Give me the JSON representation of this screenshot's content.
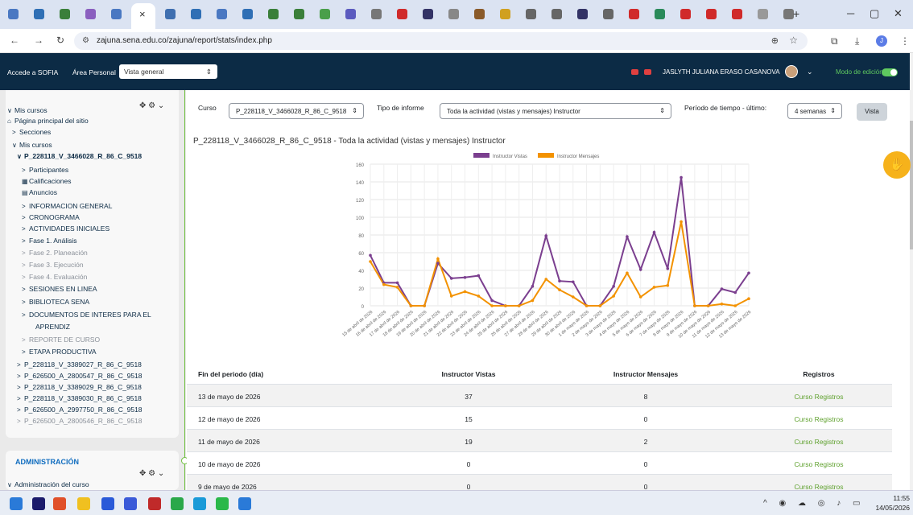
{
  "browser": {
    "url": "zajuna.sena.edu.co/zajuna/report/stats/index.php",
    "tab_close": "×",
    "new_tab": "+"
  },
  "topnav": {
    "link1": "Accede a SOFIA",
    "link2": "Área Personal",
    "view_select": "Vista general",
    "user_name": "JASLYTH JULIANA ERASO CASANOVA",
    "edit_mode": "Modo de edición"
  },
  "sidebar": {
    "items": [
      {
        "label": "Mis cursos",
        "caret": "∨"
      },
      {
        "label": "Página principal del sitio",
        "caret": "⌂"
      },
      {
        "label": "Secciones",
        "caret": ">"
      },
      {
        "label": "Mis cursos",
        "caret": "∨"
      },
      {
        "label": "P_228118_V_3466028_R_86_C_9518",
        "caret": "∨"
      },
      {
        "label": "Participantes",
        "caret": ">"
      },
      {
        "label": "Calificaciones",
        "caret": "▦"
      },
      {
        "label": "Anuncios",
        "caret": "▤"
      },
      {
        "label": "INFORMACION GENERAL",
        "caret": ">"
      },
      {
        "label": "CRONOGRAMA",
        "caret": ">"
      },
      {
        "label": "ACTIVIDADES INICIALES",
        "caret": ">"
      },
      {
        "label": "Fase 1. Análisis",
        "caret": ">"
      },
      {
        "label": "Fase 2. Planeación",
        "caret": ">"
      },
      {
        "label": "Fase 3. Ejecución",
        "caret": ">"
      },
      {
        "label": "Fase 4. Evaluación",
        "caret": ">"
      },
      {
        "label": "SESIONES EN LINEA",
        "caret": ">"
      },
      {
        "label": "BIBLIOTECA SENA",
        "caret": ">"
      },
      {
        "label": "DOCUMENTOS DE INTERES PARA EL",
        "caret": ">"
      },
      {
        "label": "APRENDIZ",
        "caret": ""
      },
      {
        "label": "REPORTE DE CURSO",
        "caret": ">"
      },
      {
        "label": "ETAPA PRODUCTIVA",
        "caret": ">"
      },
      {
        "label": "P_228118_V_3389027_R_86_C_9518",
        "caret": ">"
      },
      {
        "label": "P_626500_A_2800547_R_86_C_9518",
        "caret": ">"
      },
      {
        "label": "P_228118_V_3389029_R_86_C_9518",
        "caret": ">"
      },
      {
        "label": "P_228118_V_3389030_R_86_C_9518",
        "caret": ">"
      },
      {
        "label": "P_626500_A_2997750_R_86_C_9518",
        "caret": ">"
      },
      {
        "label": "P_626500_A_2800546_R_86_C_9518",
        "caret": ">"
      }
    ],
    "admin_title": "ADMINISTRACIÓN",
    "admin_item": "Administración del curso",
    "admin_caret": "∨"
  },
  "filters": {
    "course_label": "Curso",
    "course_value": "P_228118_V_3466028_R_86_C_9518",
    "report_label": "Tipo de informe",
    "report_value": "Toda la actividad (vistas y mensajes) Instructor",
    "period_label": "Período de tiempo - último:",
    "period_value": "4 semanas",
    "view_button": "Vista"
  },
  "chart_title": "P_228118_V_3466028_R_86_C_9518 - Toda la actividad (vistas y mensajes) Instructor",
  "colors": {
    "vistas": "#7b3f8f",
    "mensajes": "#f39200",
    "accent": "#0c2b45"
  },
  "chart_data": {
    "type": "line",
    "x": [
      "15 de abril de 2026",
      "16 de abril de 2026",
      "17 de abril de 2026",
      "18 de abril de 2026",
      "19 de abril de 2026",
      "20 de abril de 2026",
      "21 de abril de 2026",
      "22 de abril de 2026",
      "23 de abril de 2026",
      "24 de abril de 2026",
      "25 de abril de 2026",
      "26 de abril de 2026",
      "27 de abril de 2026",
      "28 de abril de 2026",
      "29 de abril de 2026",
      "30 de abril de 2026",
      "1 de mayo de 2026",
      "2 de mayo de 2026",
      "3 de mayo de 2026",
      "4 de mayo de 2026",
      "5 de mayo de 2026",
      "6 de mayo de 2026",
      "7 de mayo de 2026",
      "8 de mayo de 2026",
      "9 de mayo de 2026",
      "10 de mayo de 2026",
      "11 de mayo de 2026",
      "12 de mayo de 2026",
      "13 de mayo de 2026"
    ],
    "series": [
      {
        "name": "Instructor Vistas",
        "values": [
          57,
          26,
          26,
          0,
          0,
          48,
          31,
          32,
          34,
          6,
          0,
          0,
          22,
          79,
          28,
          27,
          0,
          0,
          22,
          78,
          41,
          83,
          42,
          145,
          0,
          0,
          19,
          15,
          37
        ]
      },
      {
        "name": "Instructor Mensajes",
        "values": [
          50,
          24,
          21,
          0,
          0,
          53,
          11,
          16,
          11,
          0,
          0,
          0,
          6,
          30,
          18,
          10,
          0,
          0,
          11,
          37,
          10,
          21,
          23,
          95,
          0,
          0,
          2,
          0,
          8
        ]
      }
    ],
    "ylim": [
      0,
      160
    ],
    "yticks": [
      0,
      20,
      40,
      60,
      80,
      100,
      120,
      140,
      160
    ],
    "legend": "top"
  },
  "table": {
    "headers": [
      "Fin del periodo (día)",
      "Instructor Vistas",
      "Instructor Mensajes",
      "Registros"
    ],
    "rows": [
      [
        "13 de mayo de 2026",
        "37",
        "8",
        "Curso Registros"
      ],
      [
        "12 de mayo de 2026",
        "15",
        "0",
        "Curso Registros"
      ],
      [
        "11 de mayo de 2026",
        "19",
        "2",
        "Curso Registros"
      ],
      [
        "10 de mayo de 2026",
        "0",
        "0",
        "Curso Registros"
      ],
      [
        "9 de mayo de 2026",
        "0",
        "0",
        "Curso Registros"
      ]
    ]
  },
  "taskbar": {
    "time": "11:55",
    "date": "14/05/2026"
  }
}
